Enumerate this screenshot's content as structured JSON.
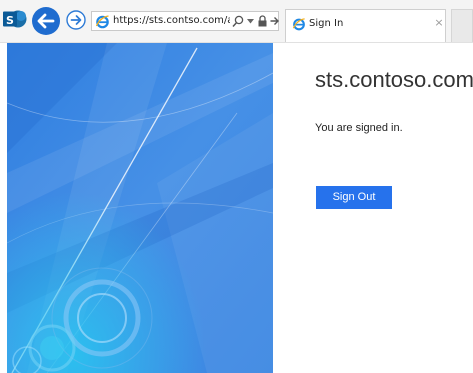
{
  "browser": {
    "address_url": "https://sts.contso.com/ad",
    "tab_title": "Sign In",
    "tab_close_glyph": "×",
    "icons": [
      "sharepoint-logo-icon",
      "back-arrow-icon",
      "forward-arrow-icon",
      "ie-icon",
      "search-icon",
      "chevron-down-icon",
      "lock-icon",
      "go-arrow-icon",
      "close-icon"
    ]
  },
  "page": {
    "site_title": "sts.contoso.com",
    "status_message": "You are signed in.",
    "signout_label": "Sign Out"
  },
  "colors": {
    "illustration_blue": "#3f87e3",
    "button_blue": "#2672ec",
    "back_button_blue": "#1f6ccf"
  }
}
